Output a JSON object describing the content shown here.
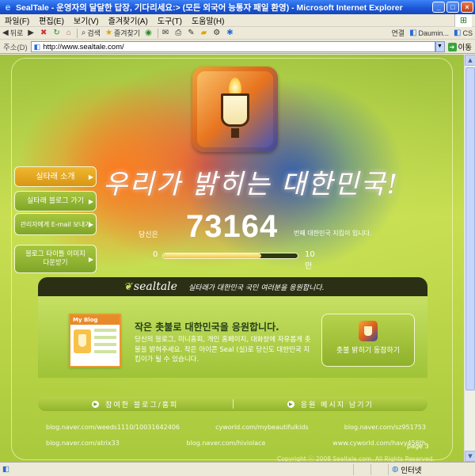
{
  "window": {
    "title": "SealTale - 운영자의 달달한 답장, 기다리세요:> (모든 외국어 능통자 패일 환영) - Microsoft Internet Explorer",
    "icon": "ie-icon",
    "controls": {
      "minimize": "_",
      "maximize": "□",
      "close": "×"
    }
  },
  "menu": {
    "items": [
      "파일(F)",
      "편집(E)",
      "보기(V)",
      "즐겨찾기(A)",
      "도구(T)",
      "도움말(H)"
    ]
  },
  "toolbar": {
    "back": "뒤로",
    "search": "검색",
    "favorites": "즐겨찾기",
    "links_label": "연결",
    "link1": "Daumin...",
    "link2": "CS"
  },
  "address": {
    "label": "주소(D)",
    "url": "http://www.sealtale.com/",
    "go": "이동"
  },
  "site": {
    "slogan": "우리가 밝히는 대한민국!",
    "nav": {
      "about": "실타래 소개",
      "blog": "실타래 블로그 가기",
      "email": "관리자에게 E-mail 보내기",
      "download_line1": "블로그 타이틀 이미지",
      "download_line2": "다운받기"
    },
    "counter": {
      "prefix": "당신은",
      "number": "73164",
      "suffix": "번째 대한민국 지킴이 입니다."
    },
    "progress": {
      "min": "0",
      "max": "10만",
      "fraction": 0.73
    },
    "band": {
      "logo": "sealtale",
      "logo_small": "실타래",
      "text": "실타래가 대한민국 국민 여러분을 응원합니다."
    },
    "promo": {
      "icon_header": "My Blog",
      "title": "작은 촛불로 대한민국을 응원합니다.",
      "description": "당신의 블로그, 미니홈피, 개인 홈페이지, 대화창에 자유롭게 촛불을 밝혀주세요. 작은 아이콘 Seal (실)로 당신도 대한민국 지킴이가 될 수 있습니다.",
      "button": "촛불 밝히기 동참하기"
    },
    "tabs": {
      "participating": "참여한 블로그/홈피",
      "message": "응원 메시지 남기기"
    },
    "links": [
      [
        "blog.naver.com/weeds1110/100316424​06",
        "cyworld.com/mybeautifulkids",
        "blog.naver.com/sz951753"
      ],
      [
        "blog.naver.com/atrix33",
        "blog.naver.com/hiviolace",
        "www.cyworld.com/havy456th"
      ]
    ],
    "page": "page 3",
    "copyright": "Copyright ⓒ 2008 Sealtale.com. All Rights Reserved."
  },
  "status": {
    "zone": "인터넷"
  },
  "colors": {
    "titlebar": "#1a55d6",
    "accent_orange": "#d79615",
    "site_green": "#b9d24a",
    "band_dark": "#2b3015"
  }
}
